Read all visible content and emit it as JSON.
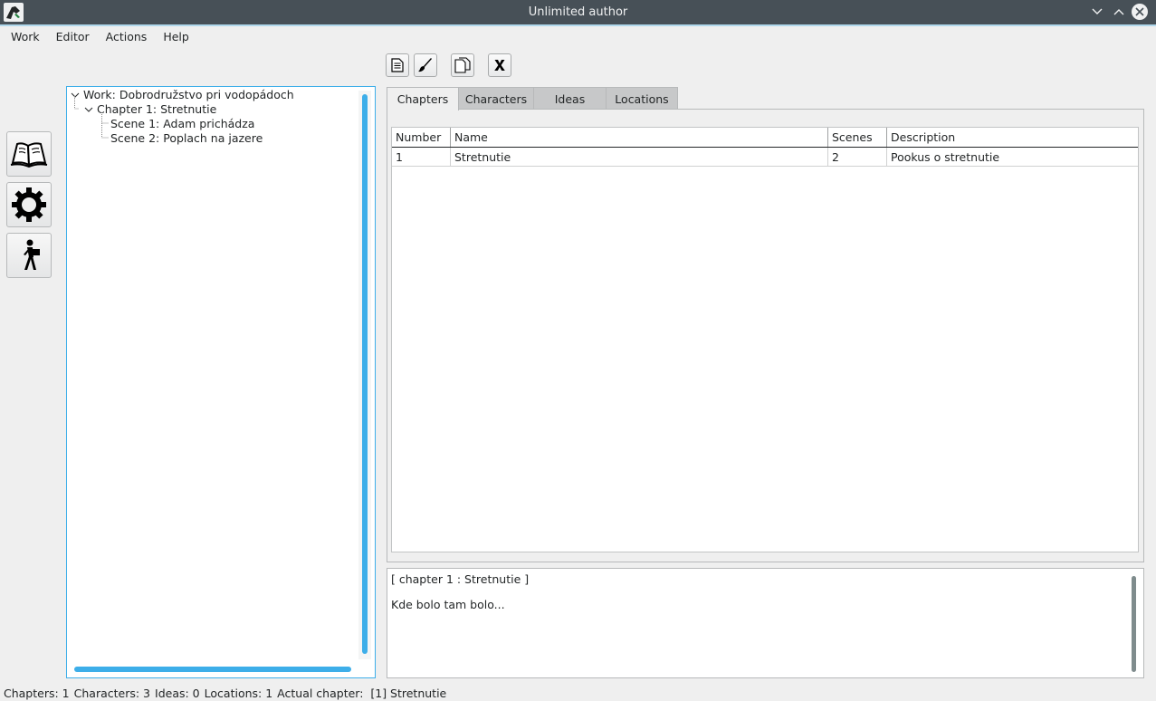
{
  "window": {
    "title": "Unlimited author"
  },
  "menu": [
    "Work",
    "Editor",
    "Actions",
    "Help"
  ],
  "side_buttons": [
    {
      "icon": "book-icon"
    },
    {
      "icon": "gear-icon"
    },
    {
      "icon": "walking-man-icon"
    }
  ],
  "toolbar": [
    {
      "icon": "document-icon"
    },
    {
      "icon": "brush-icon"
    },
    {
      "icon": "copy-icon"
    },
    {
      "icon": "x-icon"
    }
  ],
  "tree": {
    "work": "Work: Dobrodružstvo pri vodopádoch",
    "chapter": "Chapter 1: Stretnutie",
    "scenes": [
      "Scene 1: Adam prichádza",
      "Scene 2: Poplach na jazere"
    ]
  },
  "tabs": [
    "Chapters",
    "Characters",
    "Ideas",
    "Locations"
  ],
  "active_tab": "Chapters",
  "table": {
    "columns": [
      "Number",
      "Name",
      "Scenes",
      "Description"
    ],
    "rows": [
      [
        "1",
        "Stretnutie",
        "2",
        "Pookus o stretnutie"
      ]
    ]
  },
  "text": {
    "header": "[ chapter 1 : Stretnutie ]",
    "body": "Kde bolo tam bolo..."
  },
  "status": {
    "chapters": "Chapters: 1",
    "characters": "Characters: 3",
    "ideas": "Ideas: 0",
    "locations": "Locations: 1",
    "actual_chapter": "Actual chapter:  [1] Stretnutie"
  },
  "colors": {
    "titlebar": "#475057",
    "accent": "#3daee9",
    "window_bg": "#efefef"
  }
}
